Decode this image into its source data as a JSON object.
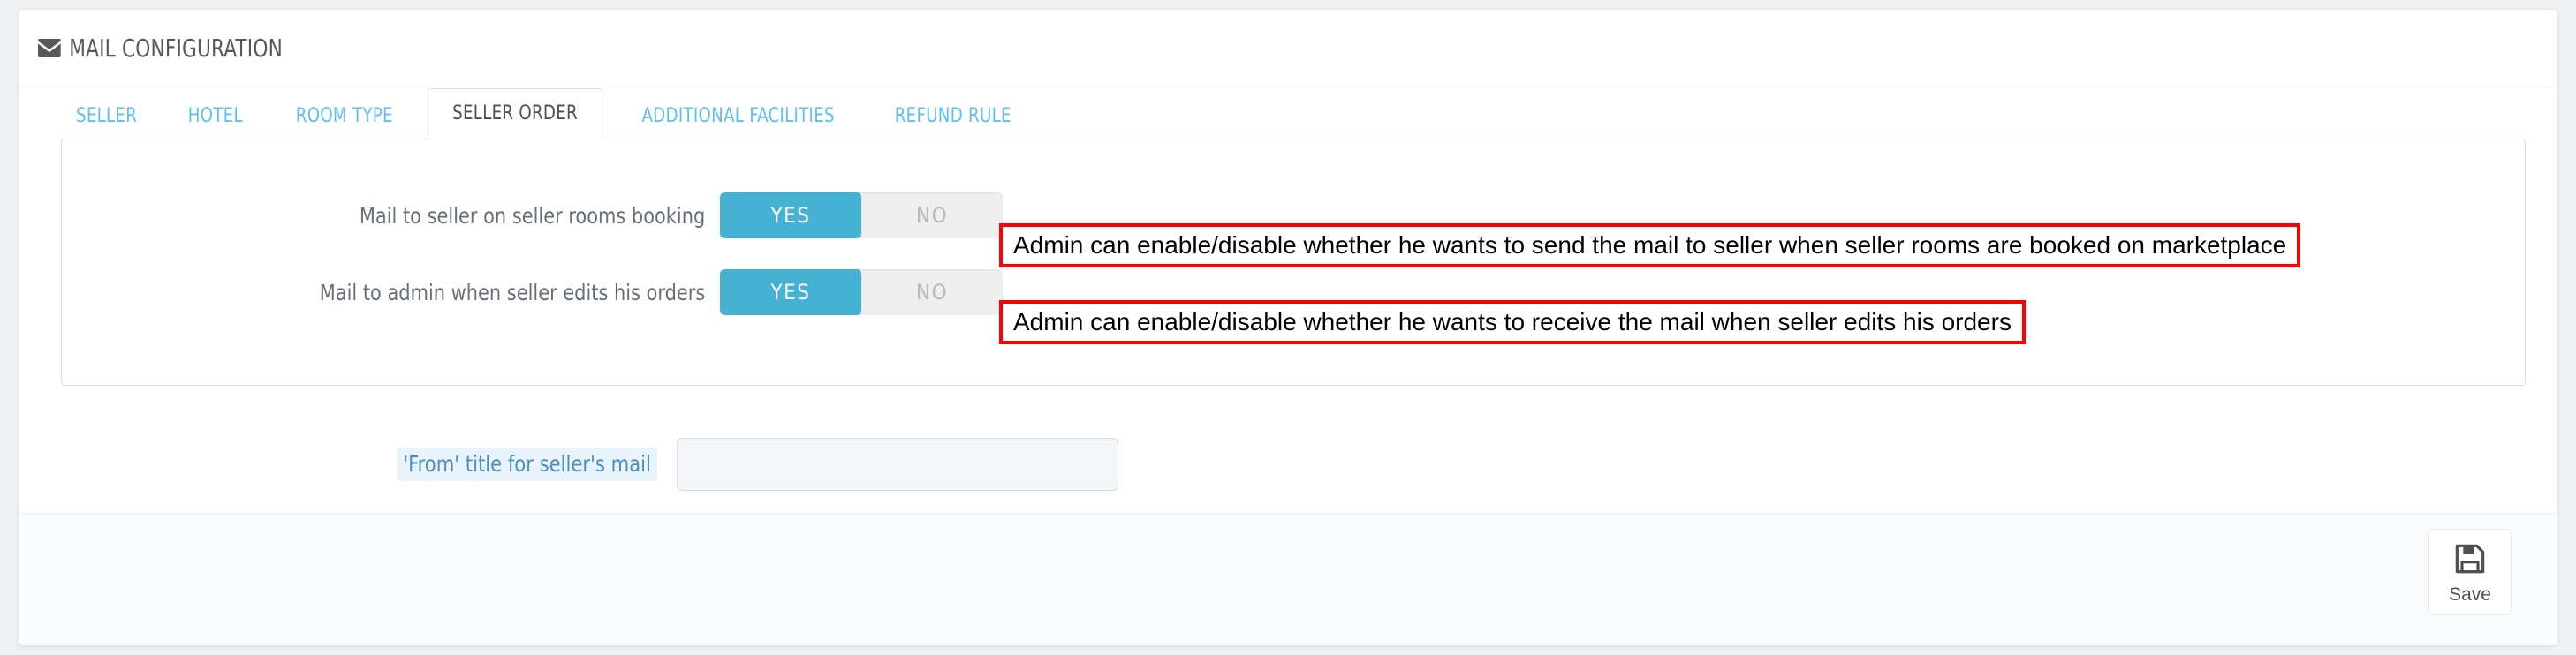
{
  "header": {
    "icon": "envelope-icon",
    "title": "MAIL CONFIGURATION"
  },
  "tabs": [
    {
      "label": "SELLER",
      "active": false
    },
    {
      "label": "HOTEL",
      "active": false
    },
    {
      "label": "ROOM TYPE",
      "active": false
    },
    {
      "label": "SELLER ORDER",
      "active": true
    },
    {
      "label": "ADDITIONAL FACILITIES",
      "active": false
    },
    {
      "label": "REFUND RULE",
      "active": false
    }
  ],
  "form": {
    "rows": [
      {
        "label": "Mail to seller on seller rooms booking",
        "yes_label": "YES",
        "no_label": "NO",
        "value": "YES",
        "annotation": "Admin can enable/disable whether he wants to send the mail to seller when seller rooms are booked on marketplace"
      },
      {
        "label": "Mail to admin when seller edits his orders",
        "yes_label": "YES",
        "no_label": "NO",
        "value": "YES",
        "annotation": "Admin can enable/disable whether he wants to receive the mail when seller edits his orders"
      }
    ],
    "from_title": {
      "label": "'From' title for seller's mail",
      "value": "",
      "placeholder": ""
    }
  },
  "footer": {
    "save_label": "Save",
    "save_icon": "floppy-disk-icon"
  },
  "colors": {
    "accent_blue": "#5bc0f0",
    "toggle_on": "#46b2d3",
    "toggle_off": "#eeeeee",
    "annotation_red": "#ff0000",
    "page_background": "#eff0f2",
    "label_highlight": "#e8f3fb"
  }
}
